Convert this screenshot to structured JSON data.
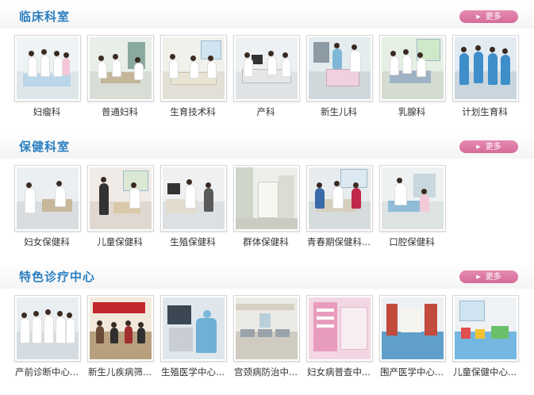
{
  "sections": [
    {
      "title": "临床科室",
      "more": "更多",
      "items": [
        "妇瘤科",
        "普通妇科",
        "生育技术科",
        "产科",
        "新生儿科",
        "乳腺科",
        "计划生育科"
      ]
    },
    {
      "title": "保健科室",
      "more": "更多",
      "items": [
        "妇女保健科",
        "儿童保健科",
        "生殖保健科",
        "群体保健科",
        "青春期保健科...",
        "口腔保健科"
      ]
    },
    {
      "title": "特色诊疗中心",
      "more": "更多",
      "items": [
        "产前诊断中心...",
        "新生儿疾病筛...",
        "生殖医学中心...",
        "宫颈病防治中...",
        "妇女病普查中...",
        "围产医学中心...",
        "儿童保健中心..."
      ]
    }
  ],
  "colors": {
    "title": "#2c7fc0",
    "more_button": "#d66a9a",
    "caption": "#333333"
  },
  "icons": {
    "more_arrow": "play-triangle-icon"
  }
}
